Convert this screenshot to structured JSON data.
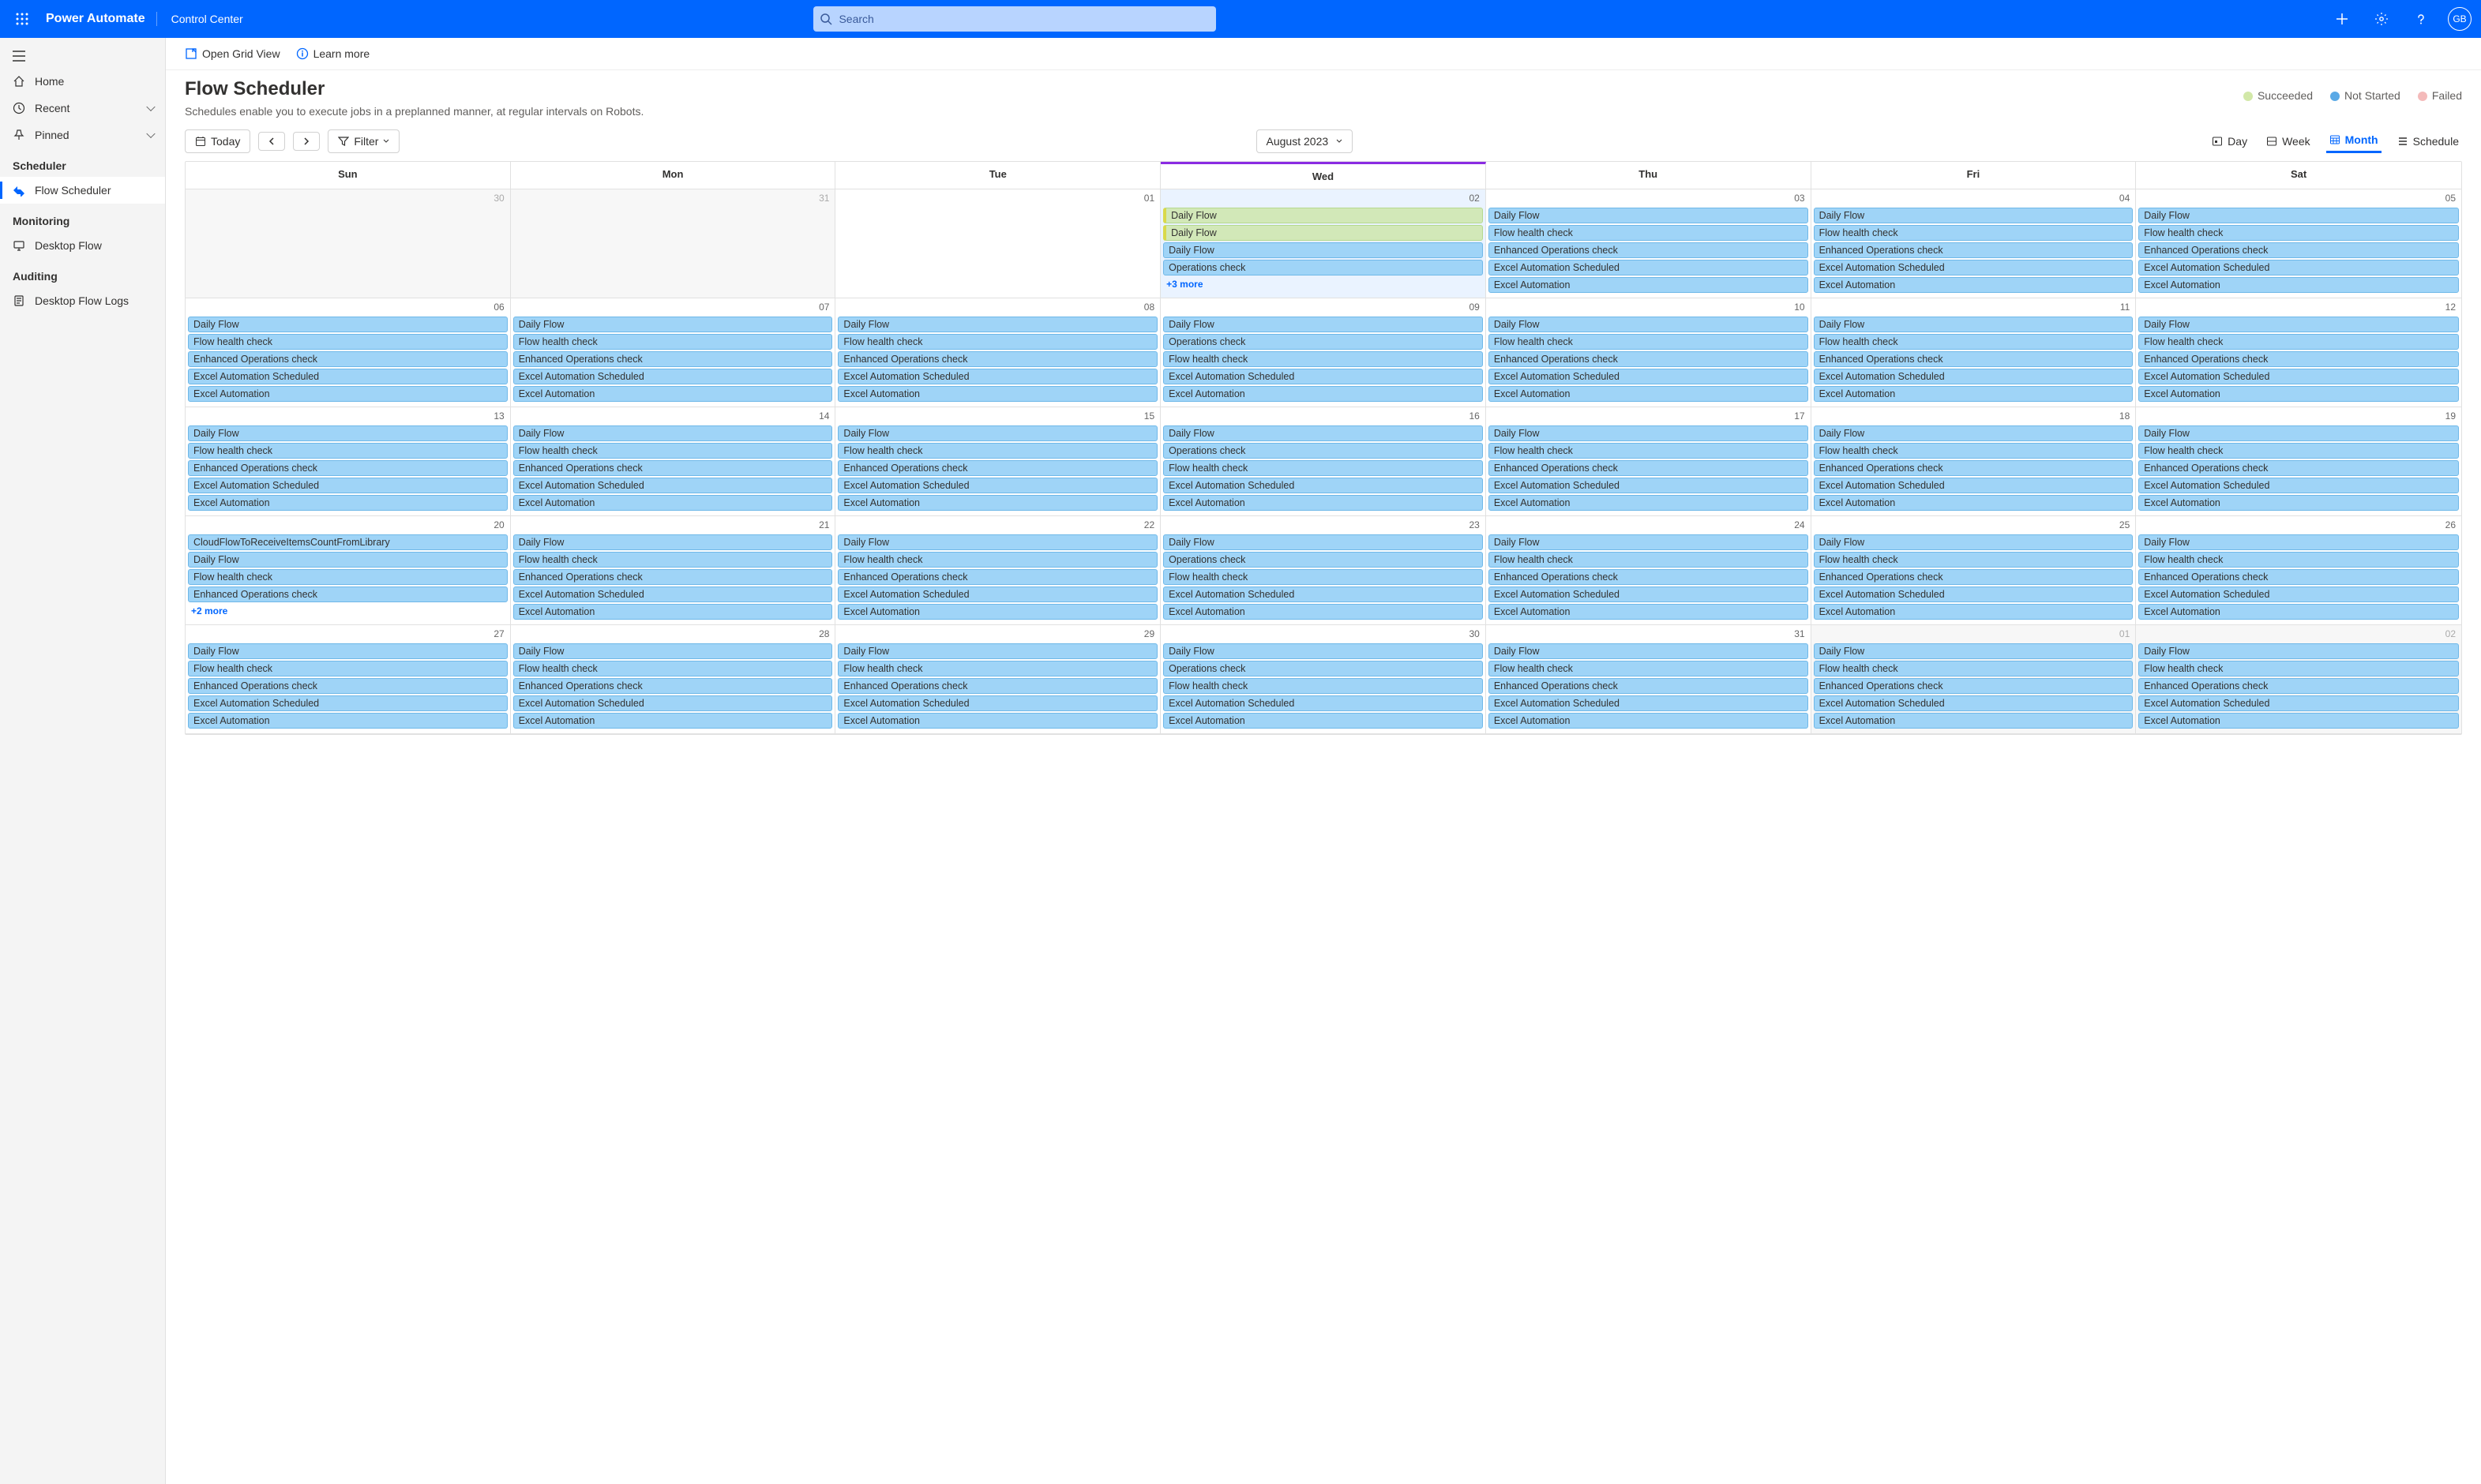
{
  "header": {
    "brand": "Power Automate",
    "crumb": "Control Center",
    "search_placeholder": "Search",
    "avatar": "GB"
  },
  "sidebar": {
    "home": "Home",
    "recent": "Recent",
    "pinned": "Pinned",
    "sched_head": "Scheduler",
    "flow_sched": "Flow Scheduler",
    "mon_head": "Monitoring",
    "desktop_flow": "Desktop Flow",
    "aud_head": "Auditing",
    "desktop_logs": "Desktop Flow Logs"
  },
  "toolbar": {
    "open_grid": "Open Grid View",
    "learn_more": "Learn more"
  },
  "page": {
    "title": "Flow Scheduler",
    "subtitle": "Schedules enable you to execute jobs in a preplanned manner, at regular intervals on Robots."
  },
  "legend": {
    "succeeded": {
      "label": "Succeeded",
      "color": "#d2e8a8"
    },
    "not_started": {
      "label": "Not Started",
      "color": "#5aa9e6"
    },
    "failed": {
      "label": "Failed",
      "color": "#f4baba"
    }
  },
  "calbar": {
    "today": "Today",
    "filter": "Filter",
    "month_label": "August 2023",
    "views": {
      "day": "Day",
      "week": "Week",
      "month": "Month",
      "schedule": "Schedule"
    }
  },
  "dow": [
    "Sun",
    "Mon",
    "Tue",
    "Wed",
    "Thu",
    "Fri",
    "Sat"
  ],
  "today_col": 3,
  "setA": [
    "Daily Flow",
    "Flow health check",
    "Enhanced Operations check",
    "Excel Automation Scheduled",
    "Excel Automation"
  ],
  "setB": [
    "Daily Flow",
    "Operations check",
    "Flow health check",
    "Excel Automation Scheduled",
    "Excel Automation"
  ],
  "weeks": [
    [
      {
        "num": "30",
        "out": true,
        "events": []
      },
      {
        "num": "31",
        "out": true,
        "events": []
      },
      {
        "num": "01",
        "events": []
      },
      {
        "num": "02",
        "today": true,
        "events": [
          {
            "t": "Daily Flow",
            "run": true
          },
          {
            "t": "Daily Flow",
            "run": true
          },
          {
            "t": "Daily Flow"
          },
          {
            "t": "Operations check"
          }
        ],
        "more": "+3 more"
      },
      {
        "num": "03",
        "set": "A"
      },
      {
        "num": "04",
        "set": "A"
      },
      {
        "num": "05",
        "set": "A"
      }
    ],
    [
      {
        "num": "06",
        "set": "A"
      },
      {
        "num": "07",
        "set": "A"
      },
      {
        "num": "08",
        "set": "A"
      },
      {
        "num": "09",
        "set": "B"
      },
      {
        "num": "10",
        "set": "A"
      },
      {
        "num": "11",
        "set": "A"
      },
      {
        "num": "12",
        "set": "A"
      }
    ],
    [
      {
        "num": "13",
        "set": "A"
      },
      {
        "num": "14",
        "set": "A"
      },
      {
        "num": "15",
        "set": "A"
      },
      {
        "num": "16",
        "set": "B"
      },
      {
        "num": "17",
        "set": "A"
      },
      {
        "num": "18",
        "set": "A"
      },
      {
        "num": "19",
        "set": "A"
      }
    ],
    [
      {
        "num": "20",
        "events": [
          {
            "t": "CloudFlowToReceiveItemsCountFromLibrary"
          },
          {
            "t": "Daily Flow"
          },
          {
            "t": "Flow health check"
          },
          {
            "t": "Enhanced Operations check"
          }
        ],
        "more": "+2 more"
      },
      {
        "num": "21",
        "set": "A"
      },
      {
        "num": "22",
        "set": "A"
      },
      {
        "num": "23",
        "set": "B"
      },
      {
        "num": "24",
        "set": "A"
      },
      {
        "num": "25",
        "set": "A"
      },
      {
        "num": "26",
        "set": "A"
      }
    ],
    [
      {
        "num": "27",
        "set": "A"
      },
      {
        "num": "28",
        "set": "A"
      },
      {
        "num": "29",
        "set": "A"
      },
      {
        "num": "30",
        "set": "B"
      },
      {
        "num": "31",
        "set": "A"
      },
      {
        "num": "01",
        "out": true,
        "set": "A"
      },
      {
        "num": "02",
        "out": true,
        "set": "A"
      }
    ]
  ]
}
